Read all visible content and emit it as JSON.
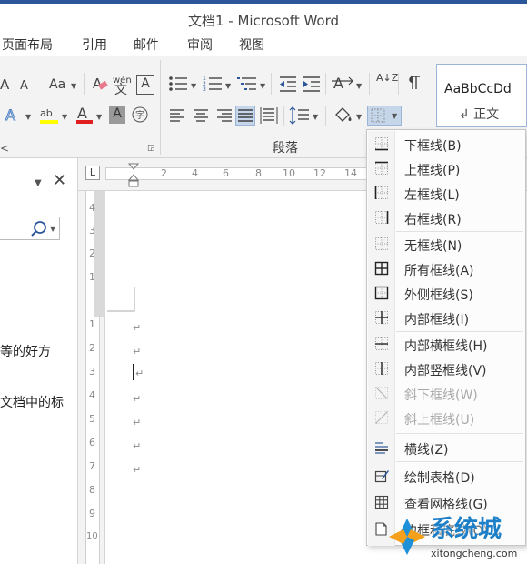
{
  "window": {
    "title": "文档1 - Microsoft Word"
  },
  "tabs": [
    "页面布局",
    "引用",
    "邮件",
    "审阅",
    "视图"
  ],
  "ribbon": {
    "font_labels": [
      "A",
      "A",
      "Aa",
      "文",
      "A"
    ],
    "pinyin_small": "wén",
    "group_label_partial": "<",
    "paragraph_group_label": "段落",
    "sort_label": "A↓Z",
    "style_sample": "AaBbCcDd",
    "style_name": "↲ 正文"
  },
  "nav": {
    "close_glyph": "✕",
    "text_1": "等的好方",
    "text_2": "文档中的标"
  },
  "ruler": {
    "h_numbers": [
      "2",
      "4",
      "6",
      "8",
      "10",
      "12",
      "14"
    ],
    "v_numbers": [
      "4",
      "3",
      "2",
      "1",
      "1",
      "2",
      "3",
      "4",
      "5",
      "6",
      "7",
      "8",
      "9",
      "10"
    ]
  },
  "document": {
    "paragraph_mark": "↵"
  },
  "border_menu": {
    "items": [
      {
        "label": "下框线(B)",
        "icon": "bottom-border-icon",
        "disabled": false
      },
      {
        "label": "上框线(P)",
        "icon": "top-border-icon",
        "disabled": false
      },
      {
        "label": "左框线(L)",
        "icon": "left-border-icon",
        "disabled": false
      },
      {
        "label": "右框线(R)",
        "icon": "right-border-icon",
        "disabled": false
      },
      {
        "label": "无框线(N)",
        "icon": "no-border-icon",
        "disabled": false
      },
      {
        "label": "所有框线(A)",
        "icon": "all-borders-icon",
        "disabled": false
      },
      {
        "label": "外侧框线(S)",
        "icon": "outside-borders-icon",
        "disabled": false
      },
      {
        "label": "内部框线(I)",
        "icon": "inside-borders-icon",
        "disabled": false
      },
      {
        "label": "内部横框线(H)",
        "icon": "inside-horizontal-border-icon",
        "disabled": false
      },
      {
        "label": "内部竖框线(V)",
        "icon": "inside-vertical-border-icon",
        "disabled": false
      },
      {
        "label": "斜下框线(W)",
        "icon": "diagonal-down-border-icon",
        "disabled": true
      },
      {
        "label": "斜上框线(U)",
        "icon": "diagonal-up-border-icon",
        "disabled": true
      },
      {
        "label": "横线(Z)",
        "icon": "horizontal-line-icon",
        "disabled": false
      },
      {
        "label": "绘制表格(D)",
        "icon": "draw-table-icon",
        "disabled": false
      },
      {
        "label": "查看网格线(G)",
        "icon": "view-gridlines-icon",
        "disabled": false
      },
      {
        "label": "边框和底纹(O)...",
        "icon": "borders-shading-icon",
        "disabled": false
      }
    ]
  },
  "watermark": {
    "brand": "系统城",
    "url": "xitongcheng.com"
  },
  "colors": {
    "accent": "#2b579a",
    "highlight": "#c5d5ea",
    "font_red": "#e02020",
    "highlight_yellow": "#ffff00"
  }
}
